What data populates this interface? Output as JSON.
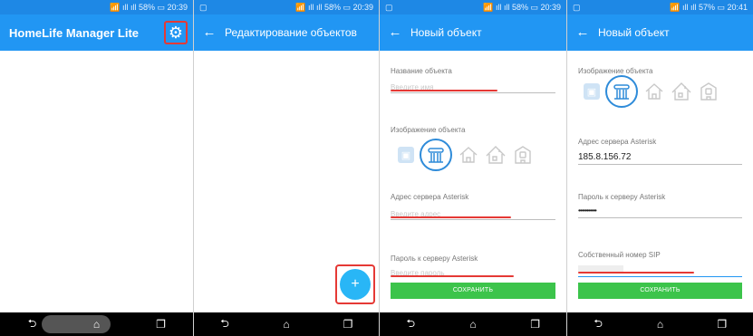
{
  "status": {
    "p1": {
      "icons": "📶 ıll ıll 58% ▭ 20:39"
    },
    "p2": {
      "icons": "📶 ıll ıll 58% ▭ 20:39",
      "left": "▢"
    },
    "p3": {
      "icons": "📶 ıll ıll 58% ▭ 20:39",
      "left": "▢"
    },
    "p4": {
      "icons": "📶 ıll ıll 57% ▭ 20:41",
      "left": "▢"
    }
  },
  "screen1": {
    "title": "HomeLife Manager Lite",
    "settings_icon": "gear-icon"
  },
  "screen2": {
    "title": "Редактирование объектов",
    "fab": "+"
  },
  "screen3": {
    "title": "Новый объект",
    "name_label": "Название объекта",
    "name_placeholder": "Введите имя",
    "image_label": "Изображение объекта",
    "server_label": "Адрес сервера Asterisk",
    "server_placeholder": "Введите адрес",
    "password_label": "Пароль к серверу Asterisk",
    "password_placeholder": "Введите пароль",
    "save_label": "СОХРАНИТЬ"
  },
  "screen4": {
    "title": "Новый объект",
    "image_label": "Изображение объекта",
    "server_label": "Адрес сервера Asterisk",
    "server_value": "185.8.156.72",
    "password_label": "Пароль к серверу Asterisk",
    "password_value": "•••••••••••",
    "sip_label": "Собственный номер SIP",
    "save_label": "СОХРАНИТЬ"
  },
  "nav": {
    "back": "⮌",
    "home": "⌂",
    "recent": "❐"
  },
  "colors": {
    "appbar": "#2196f3",
    "accent": "#2e8bd9",
    "save": "#3cc44b",
    "fab": "#29b6f6",
    "highlight": "#e53935"
  }
}
